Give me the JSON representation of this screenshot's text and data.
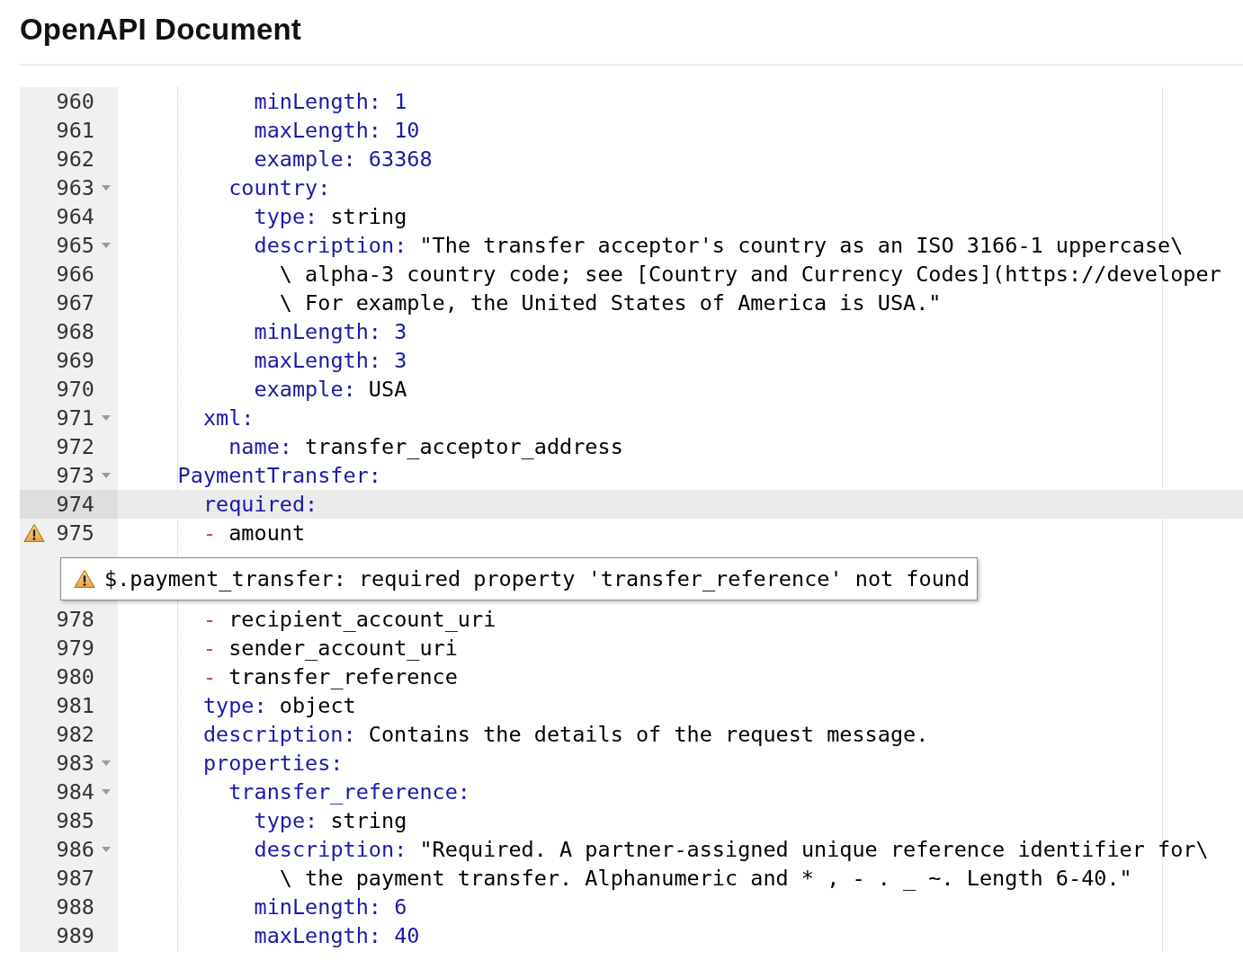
{
  "header": {
    "title": "OpenAPI Document"
  },
  "editor": {
    "lines": [
      {
        "kind": "group",
        "children": [
          {
            "kind": "group",
            "children": [
              {
                "kind": "group",
                "children": [
                  {
                    "kind": "code",
                    "number": "960",
                    "fold": false,
                    "warning": false,
                    "active": false,
                    "tokens": [
                      {
                        "kind": "key",
                        "text": "minLength:"
                      },
                      {
                        "kind": "number",
                        "text": "1"
                      }
                    ]
                  },
                  {
                    "kind": "code",
                    "number": "961",
                    "fold": false,
                    "warning": false,
                    "active": false,
                    "tokens": [
                      {
                        "kind": "key",
                        "text": "maxLength:"
                      },
                      {
                        "kind": "number",
                        "text": "10"
                      }
                    ]
                  },
                  {
                    "kind": "code",
                    "number": "962",
                    "fold": false,
                    "warning": false,
                    "active": false,
                    "tokens": [
                      {
                        "kind": "key",
                        "text": "example:"
                      },
                      {
                        "kind": "number",
                        "text": "63368"
                      }
                    ]
                  }
                ]
              },
              {
                "kind": "code",
                "number": "963",
                "fold": true,
                "warning": false,
                "active": false,
                "tokens": [
                  {
                    "kind": "key",
                    "text": "country:"
                  }
                ],
                "children": [
                  {
                    "kind": "code",
                    "number": "964",
                    "fold": false,
                    "warning": false,
                    "active": false,
                    "tokens": [
                      {
                        "kind": "key",
                        "text": "type:"
                      },
                      {
                        "kind": "string",
                        "text": "string"
                      }
                    ]
                  },
                  {
                    "kind": "code",
                    "number": "965",
                    "fold": true,
                    "warning": false,
                    "active": false,
                    "tokens": [
                      {
                        "kind": "key",
                        "text": "description:"
                      },
                      {
                        "kind": "string",
                        "text": "\"The transfer acceptor's country as an ISO 3166-1 uppercase\\"
                      }
                    ],
                    "children": [
                      {
                        "kind": "code",
                        "number": "966",
                        "fold": false,
                        "warning": false,
                        "active": false,
                        "tokens": [
                          {
                            "kind": "string",
                            "text": "\\ alpha-3 country code; see [Country and Currency Codes](https://developer"
                          }
                        ]
                      },
                      {
                        "kind": "code",
                        "number": "967",
                        "fold": false,
                        "warning": false,
                        "active": false,
                        "tokens": [
                          {
                            "kind": "string",
                            "text": "\\ For example, the United States of America is USA.\""
                          }
                        ]
                      }
                    ]
                  },
                  {
                    "kind": "code",
                    "number": "968",
                    "fold": false,
                    "warning": false,
                    "active": false,
                    "tokens": [
                      {
                        "kind": "key",
                        "text": "minLength:"
                      },
                      {
                        "kind": "number",
                        "text": "3"
                      }
                    ]
                  },
                  {
                    "kind": "code",
                    "number": "969",
                    "fold": false,
                    "warning": false,
                    "active": false,
                    "tokens": [
                      {
                        "kind": "key",
                        "text": "maxLength:"
                      },
                      {
                        "kind": "number",
                        "text": "3"
                      }
                    ]
                  },
                  {
                    "kind": "code",
                    "number": "970",
                    "fold": false,
                    "warning": false,
                    "active": false,
                    "tokens": [
                      {
                        "kind": "key",
                        "text": "example:"
                      },
                      {
                        "kind": "string",
                        "text": "USA"
                      }
                    ]
                  }
                ]
              }
            ]
          },
          {
            "kind": "code",
            "number": "971",
            "fold": true,
            "warning": false,
            "active": false,
            "tokens": [
              {
                "kind": "key",
                "text": "xml:"
              }
            ],
            "children": [
              {
                "kind": "code",
                "number": "972",
                "fold": false,
                "warning": false,
                "active": false,
                "tokens": [
                  {
                    "kind": "key",
                    "text": "name:"
                  },
                  {
                    "kind": "string",
                    "text": "transfer_acceptor_address"
                  }
                ]
              }
            ]
          }
        ]
      },
      {
        "kind": "code",
        "number": "973",
        "fold": true,
        "warning": false,
        "active": false,
        "tokens": [
          {
            "kind": "key",
            "text": "PaymentTransfer:"
          }
        ],
        "children": [
          {
            "kind": "code",
            "number": "974",
            "fold": false,
            "warning": false,
            "active": true,
            "tokens": [
              {
                "kind": "key",
                "text": "required:"
              }
            ]
          },
          {
            "kind": "code",
            "number": "975",
            "fold": false,
            "warning": true,
            "active": false,
            "tokens": [
              {
                "kind": "dash",
                "text": "-"
              },
              {
                "kind": "string",
                "text": "amount"
              }
            ]
          },
          {
            "kind": "covered"
          },
          {
            "kind": "covered"
          },
          {
            "kind": "code",
            "number": "978",
            "fold": false,
            "warning": false,
            "active": false,
            "tokens": [
              {
                "kind": "dash",
                "text": "-"
              },
              {
                "kind": "string",
                "text": "recipient_account_uri"
              }
            ]
          },
          {
            "kind": "code",
            "number": "979",
            "fold": false,
            "warning": false,
            "active": false,
            "tokens": [
              {
                "kind": "dash",
                "text": "-"
              },
              {
                "kind": "string",
                "text": "sender_account_uri"
              }
            ]
          },
          {
            "kind": "code",
            "number": "980",
            "fold": false,
            "warning": false,
            "active": false,
            "tokens": [
              {
                "kind": "dash",
                "text": "-"
              },
              {
                "kind": "string",
                "text": "transfer_reference"
              }
            ]
          },
          {
            "kind": "code",
            "number": "981",
            "fold": false,
            "warning": false,
            "active": false,
            "tokens": [
              {
                "kind": "key",
                "text": "type:"
              },
              {
                "kind": "string",
                "text": "object"
              }
            ]
          },
          {
            "kind": "code",
            "number": "982",
            "fold": false,
            "warning": false,
            "active": false,
            "tokens": [
              {
                "kind": "key",
                "text": "description:"
              },
              {
                "kind": "string",
                "text": "Contains the details of the request message."
              }
            ]
          },
          {
            "kind": "code",
            "number": "983",
            "fold": true,
            "warning": false,
            "active": false,
            "tokens": [
              {
                "kind": "key",
                "text": "properties:"
              }
            ],
            "children": [
              {
                "kind": "code",
                "number": "984",
                "fold": true,
                "warning": false,
                "active": false,
                "tokens": [
                  {
                    "kind": "key",
                    "text": "transfer_reference:"
                  }
                ],
                "children": [
                  {
                    "kind": "code",
                    "number": "985",
                    "fold": false,
                    "warning": false,
                    "active": false,
                    "tokens": [
                      {
                        "kind": "key",
                        "text": "type:"
                      },
                      {
                        "kind": "string",
                        "text": "string"
                      }
                    ]
                  },
                  {
                    "kind": "code",
                    "number": "986",
                    "fold": true,
                    "warning": false,
                    "active": false,
                    "tokens": [
                      {
                        "kind": "key",
                        "text": "description:"
                      },
                      {
                        "kind": "string",
                        "text": "\"Required. A partner-assigned unique reference identifier for\\"
                      }
                    ],
                    "children": [
                      {
                        "kind": "code",
                        "number": "987",
                        "fold": false,
                        "warning": false,
                        "active": false,
                        "tokens": [
                          {
                            "kind": "string",
                            "text": "\\ the payment transfer. Alphanumeric and * , - . _ ~. Length 6-40.\""
                          }
                        ]
                      }
                    ]
                  },
                  {
                    "kind": "code",
                    "number": "988",
                    "fold": false,
                    "warning": false,
                    "active": false,
                    "tokens": [
                      {
                        "kind": "key",
                        "text": "minLength:"
                      },
                      {
                        "kind": "number",
                        "text": "6"
                      }
                    ]
                  },
                  {
                    "kind": "code",
                    "number": "989",
                    "fold": false,
                    "warning": false,
                    "active": false,
                    "tokens": [
                      {
                        "kind": "key",
                        "text": "maxLength:"
                      },
                      {
                        "kind": "number",
                        "text": "40"
                      }
                    ]
                  }
                ]
              }
            ]
          }
        ]
      }
    ],
    "tooltip": {
      "text": "$.payment_transfer: required property 'transfer_reference' not found"
    }
  }
}
